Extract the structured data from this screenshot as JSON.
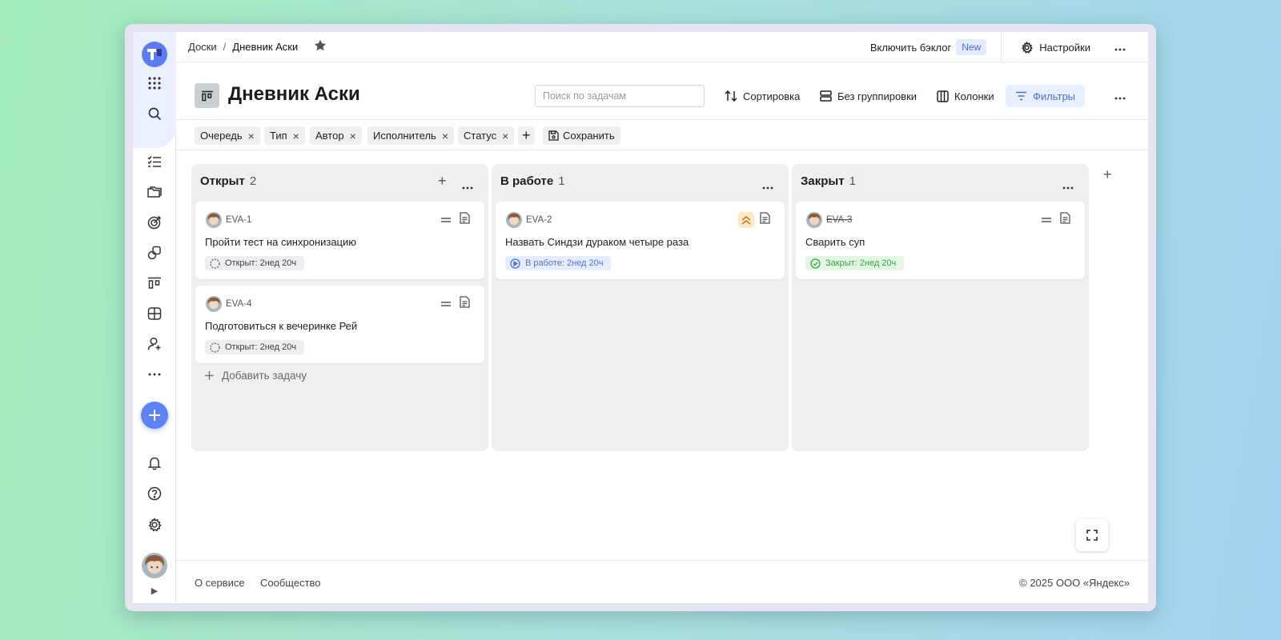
{
  "breadcrumb": {
    "root": "Доски",
    "separator": "/",
    "current": "Дневник Аски"
  },
  "topbar": {
    "backlog_label": "Включить бэклог",
    "new_badge": "New",
    "settings_label": "Настройки"
  },
  "header": {
    "title": "Дневник Аски",
    "search_placeholder": "Поиск по задачам",
    "sort_label": "Сортировка",
    "grouping_label": "Без группировки",
    "columns_label": "Колонки",
    "filters_label": "Фильтры"
  },
  "filters": {
    "chips": [
      "Очередь",
      "Тип",
      "Автор",
      "Исполнитель",
      "Статус"
    ],
    "remove_glyph": "×",
    "add_glyph": "+",
    "save_label": "Сохранить"
  },
  "columns": [
    {
      "title": "Открыт",
      "count": "2",
      "cards": [
        {
          "key": "EVA-1",
          "title": "Пройти тест на синхронизацию",
          "priority": "normal",
          "status": "Открыт: 2нед 20ч"
        },
        {
          "key": "EVA-4",
          "title": "Подготовиться к вечеринке Рей",
          "priority": "normal",
          "status": "Открыт: 2нед 20ч"
        }
      ],
      "add_task_label": "Добавить задачу"
    },
    {
      "title": "В работе",
      "count": "1",
      "cards": [
        {
          "key": "EVA-2",
          "title": "Назвать Синдзи дураком четыре раза",
          "priority": "high",
          "status": "В работе: 2нед 20ч"
        }
      ]
    },
    {
      "title": "Закрыт",
      "count": "1",
      "cards": [
        {
          "key": "EVA-3",
          "title": "Сварить суп",
          "priority": "normal",
          "status": "Закрыт: 2нед 20ч"
        }
      ]
    }
  ],
  "footer": {
    "about": "О сервисе",
    "community": "Сообщество",
    "copyright": "© 2025 ООО «Яндекс»"
  },
  "colors": {
    "accent": "#5d83f7",
    "filters_bg": "#e8efff",
    "open_status": "#3f3f3f",
    "work_status": "#4f72d9",
    "done_status": "#3aa048",
    "high_priority": "#fde9c7"
  },
  "icons": {
    "sidebar": [
      "apps-grid-icon",
      "search-icon",
      "tasks-list-icon",
      "folders-icon",
      "goals-icon",
      "projects-icon",
      "boards-icon",
      "tables-icon",
      "add-user-icon",
      "more-icon",
      "bell-icon",
      "help-icon",
      "gear-icon"
    ]
  }
}
